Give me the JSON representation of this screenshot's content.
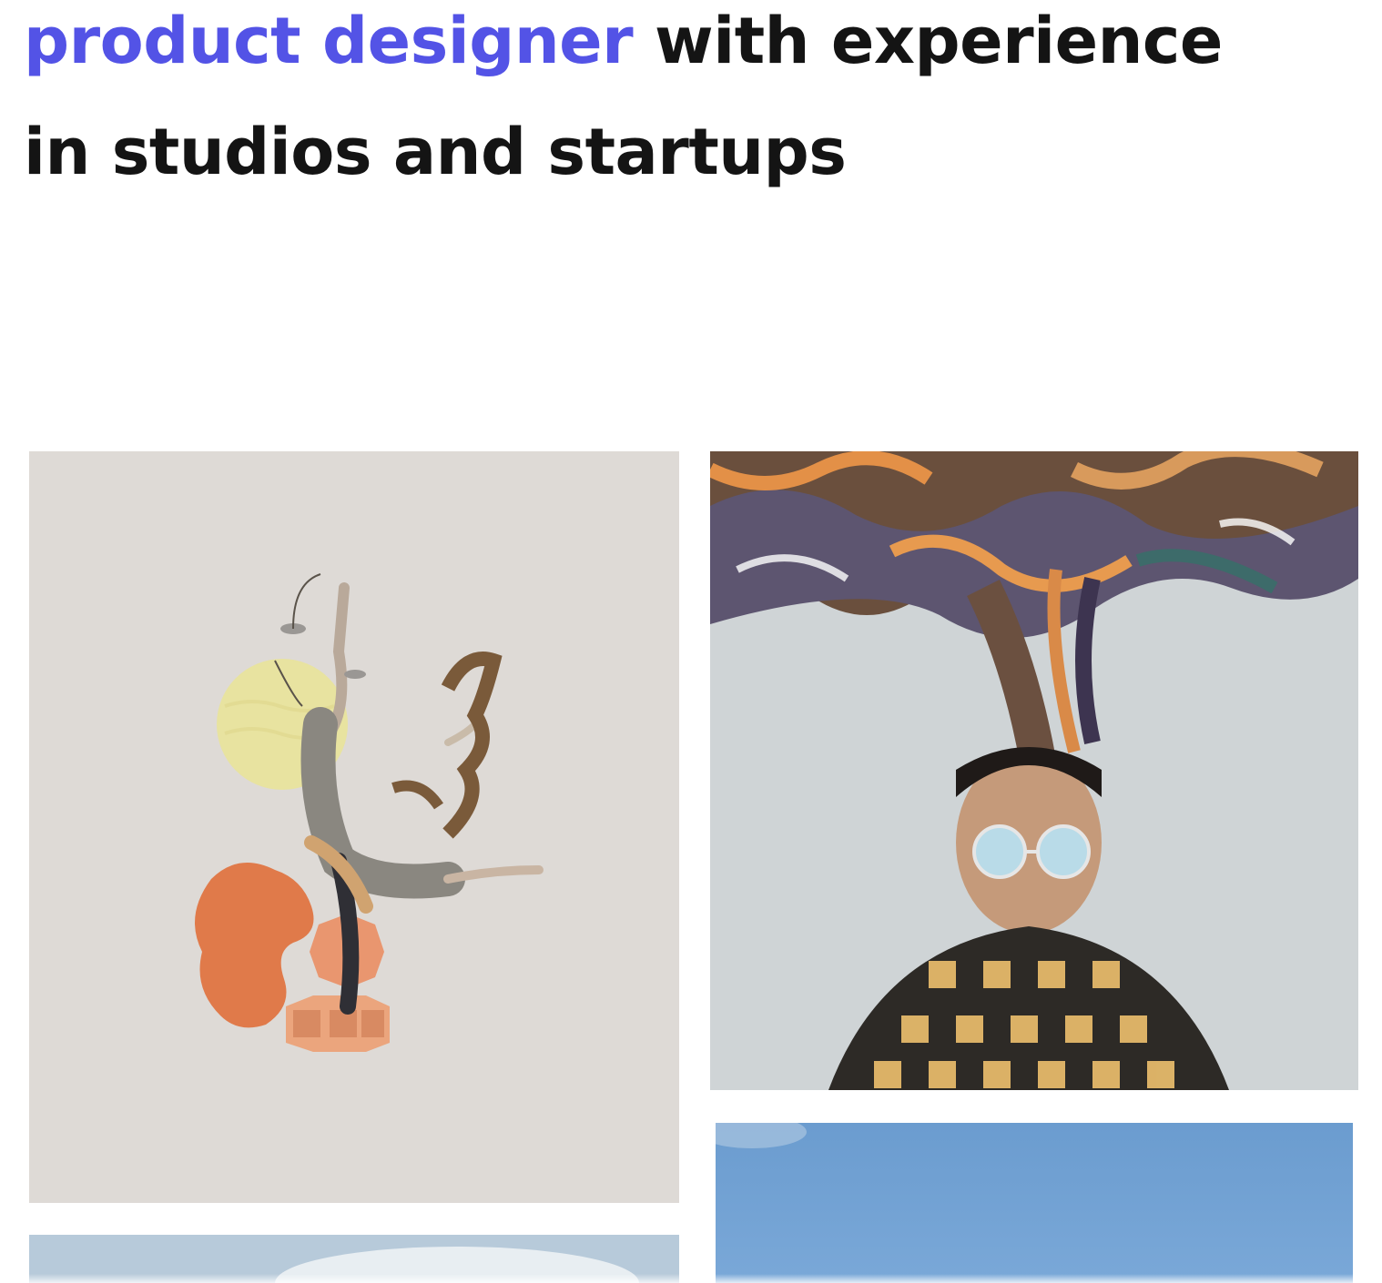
{
  "hero": {
    "line1_accent": "product designer",
    "line1_rest": " with experience",
    "line2": "in studios and startups"
  },
  "colors": {
    "accent": "#5353e6",
    "text": "#141414",
    "background": "#ffffff"
  },
  "gallery": [
    {
      "name": "collage-dancer-artwork",
      "alt": "collage artwork"
    },
    {
      "name": "surreal-portrait-artwork",
      "alt": "portrait artwork"
    },
    {
      "name": "sky-photo-left",
      "alt": "sky photo"
    },
    {
      "name": "sky-photo-right",
      "alt": "sky photo"
    }
  ]
}
